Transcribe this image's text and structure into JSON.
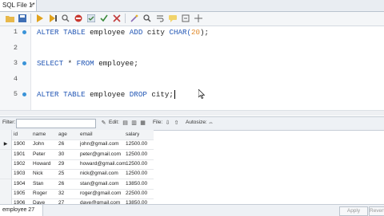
{
  "tab": {
    "title": "SQL File 1*",
    "close": "×"
  },
  "toolbar": {
    "icons": [
      "folder-open-icon",
      "save-icon",
      "execute-icon",
      "execute-line-icon",
      "explain-icon",
      "stop-icon",
      "toggle-icon",
      "commit-icon",
      "rollback-icon",
      "beautify-icon",
      "find-icon",
      "wrap-icon",
      "comment-icon",
      "invisible-icon",
      "limit-icon"
    ]
  },
  "editor": {
    "lines": [
      {
        "num": "1",
        "has_dot": true,
        "tokens": [
          {
            "t": "ALTER TABLE",
            "c": "kw"
          },
          {
            "t": " employee ",
            "c": ""
          },
          {
            "t": "ADD",
            "c": "kw"
          },
          {
            "t": " city ",
            "c": ""
          },
          {
            "t": "CHAR(",
            "c": "kw"
          },
          {
            "t": "20",
            "c": "num"
          },
          {
            "t": ");",
            "c": ""
          }
        ]
      },
      {
        "num": "2",
        "has_dot": false,
        "tokens": []
      },
      {
        "num": "3",
        "has_dot": true,
        "tokens": [
          {
            "t": "SELECT",
            "c": "kw"
          },
          {
            "t": " * ",
            "c": ""
          },
          {
            "t": "FROM",
            "c": "kw"
          },
          {
            "t": " employee;",
            "c": ""
          }
        ]
      },
      {
        "num": "4",
        "has_dot": false,
        "tokens": []
      },
      {
        "num": "5",
        "has_dot": true,
        "tokens": [
          {
            "t": "ALTER TABLE",
            "c": "kw"
          },
          {
            "t": " employee ",
            "c": ""
          },
          {
            "t": "DROP",
            "c": "kw"
          },
          {
            "t": " city;",
            "c": ""
          }
        ]
      }
    ]
  },
  "results": {
    "filter_label": "Filter:",
    "edit_label": "Edit:",
    "file_label": "File:",
    "autosize_label": "Autosize:",
    "columns": [
      "id",
      "name",
      "age",
      "email",
      "salary"
    ],
    "rows": [
      [
        "1900",
        "John",
        "26",
        "john@gmail.com",
        "12500.00"
      ],
      [
        "1901",
        "Peter",
        "30",
        "peter@gmail.com",
        "12500.00"
      ],
      [
        "1902",
        "Howard",
        "29",
        "howard@gmail.com",
        "12500.00"
      ],
      [
        "1903",
        "Nick",
        "25",
        "nick@gmail.com",
        "12500.00"
      ],
      [
        "1904",
        "Stan",
        "26",
        "stan@gmail.com",
        "13850.00"
      ],
      [
        "1905",
        "Roger",
        "32",
        "roger@gmail.com",
        "22500.00"
      ],
      [
        "1906",
        "Dave",
        "27",
        "dave@gmail.com",
        "13850.00"
      ]
    ],
    "selected_row_marker": "▶"
  },
  "status": {
    "result_tab": "employee 27",
    "apply_label": "Apply",
    "revert_label": "Revert"
  },
  "colors": {
    "keyword": "#2458b5",
    "number": "#e08a2b",
    "accent": "#3a93d8"
  }
}
